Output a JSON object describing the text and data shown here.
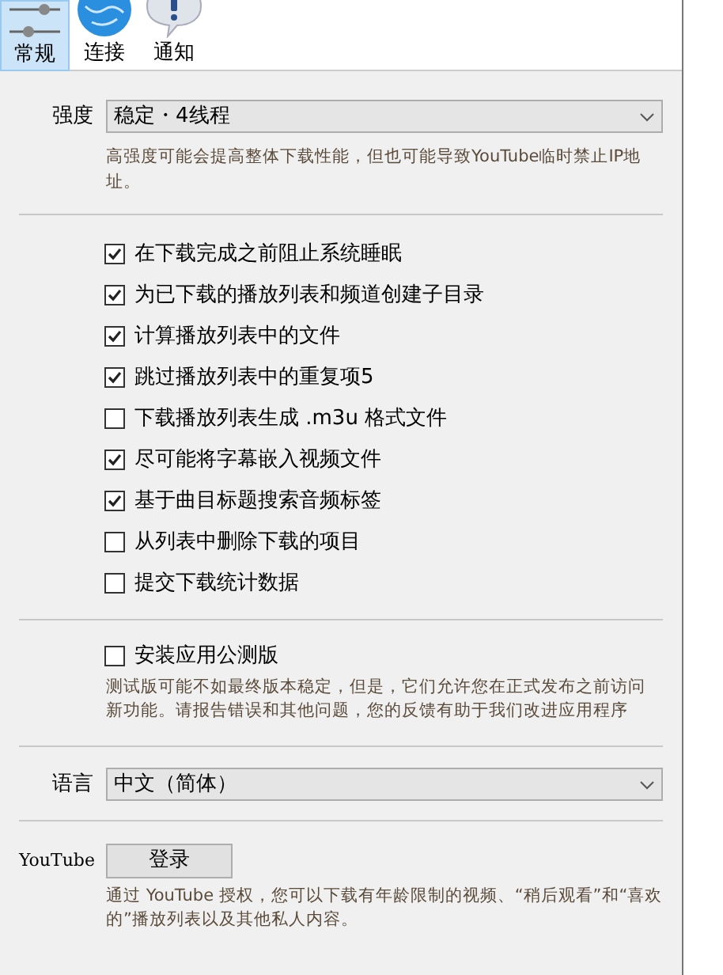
{
  "tabs": [
    {
      "label": "常规",
      "kind": "sliders",
      "selected": true
    },
    {
      "label": "连接",
      "kind": "globe",
      "selected": false
    },
    {
      "label": "通知",
      "kind": "alert",
      "selected": false
    }
  ],
  "strength": {
    "label": "强度",
    "value": "稳定・4线程",
    "help": "高强度可能会提高整体下载性能，但也可能导致YouTube临时禁止IP地址。"
  },
  "options": [
    {
      "label": "在下载完成之前阻止系统睡眠",
      "checked": true
    },
    {
      "label": "为已下载的播放列表和频道创建子目录",
      "checked": true
    },
    {
      "label": "计算播放列表中的文件",
      "checked": true
    },
    {
      "label": "跳过播放列表中的重复项5",
      "checked": true
    },
    {
      "label": "下载播放列表生成 .m3u 格式文件",
      "checked": false
    },
    {
      "label": "尽可能将字幕嵌入视频文件",
      "checked": true
    },
    {
      "label": "基于曲目标题搜索音频标签",
      "checked": true
    },
    {
      "label": "从列表中删除下载的项目",
      "checked": false
    },
    {
      "label": "提交下载统计数据",
      "checked": false
    }
  ],
  "beta": {
    "label": "安装应用公测版",
    "checked": false,
    "help": "测试版可能不如最终版本稳定，但是，它们允许您在正式发布之前访问新功能。请报告错误和其他问题，您的反馈有助于我们改进应用程序"
  },
  "language": {
    "label": "语言",
    "value": "中文（简体）"
  },
  "youtube": {
    "label": "YouTube",
    "button": "登录",
    "help": "通过 YouTube 授权，您可以下载有年龄限制的视频、“稍后观看”和“喜欢的”播放列表以及其他私人内容。"
  }
}
